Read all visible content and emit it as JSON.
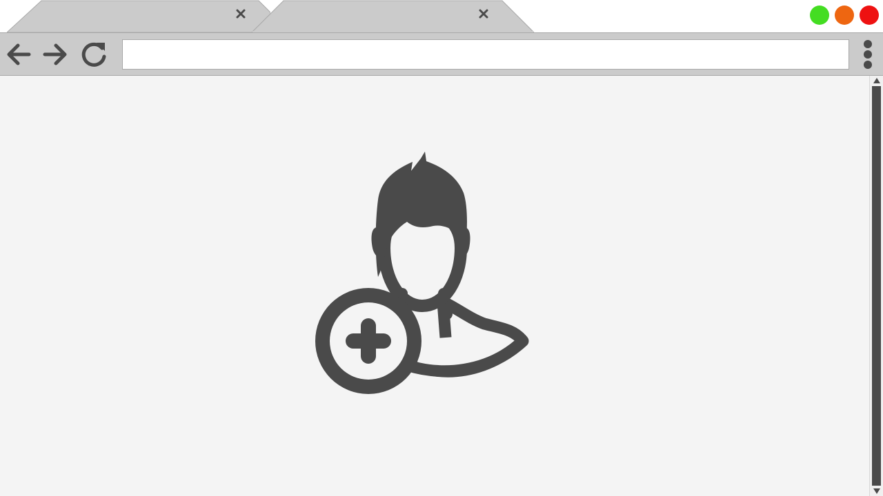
{
  "browser": {
    "tabs": [
      {
        "title": "",
        "icon": "close-icon",
        "active": false
      },
      {
        "title": "",
        "icon": "close-icon",
        "active": true
      }
    ],
    "window_controls": [
      {
        "name": "maximize",
        "color": "#44dd22"
      },
      {
        "name": "minimize",
        "color": "#ee6611"
      },
      {
        "name": "close",
        "color": "#ee1111"
      }
    ],
    "toolbar": {
      "back_icon": "arrow-left-icon",
      "forward_icon": "arrow-right-icon",
      "reload_icon": "reload-icon",
      "address_value": "",
      "menu_icon": "more-vertical-icon"
    }
  },
  "content": {
    "illustration_icon": "add-user-icon"
  },
  "colors": {
    "chrome": "#cbcbcb",
    "icon": "#4a4a4a",
    "page_background": "#f4f4f4"
  }
}
